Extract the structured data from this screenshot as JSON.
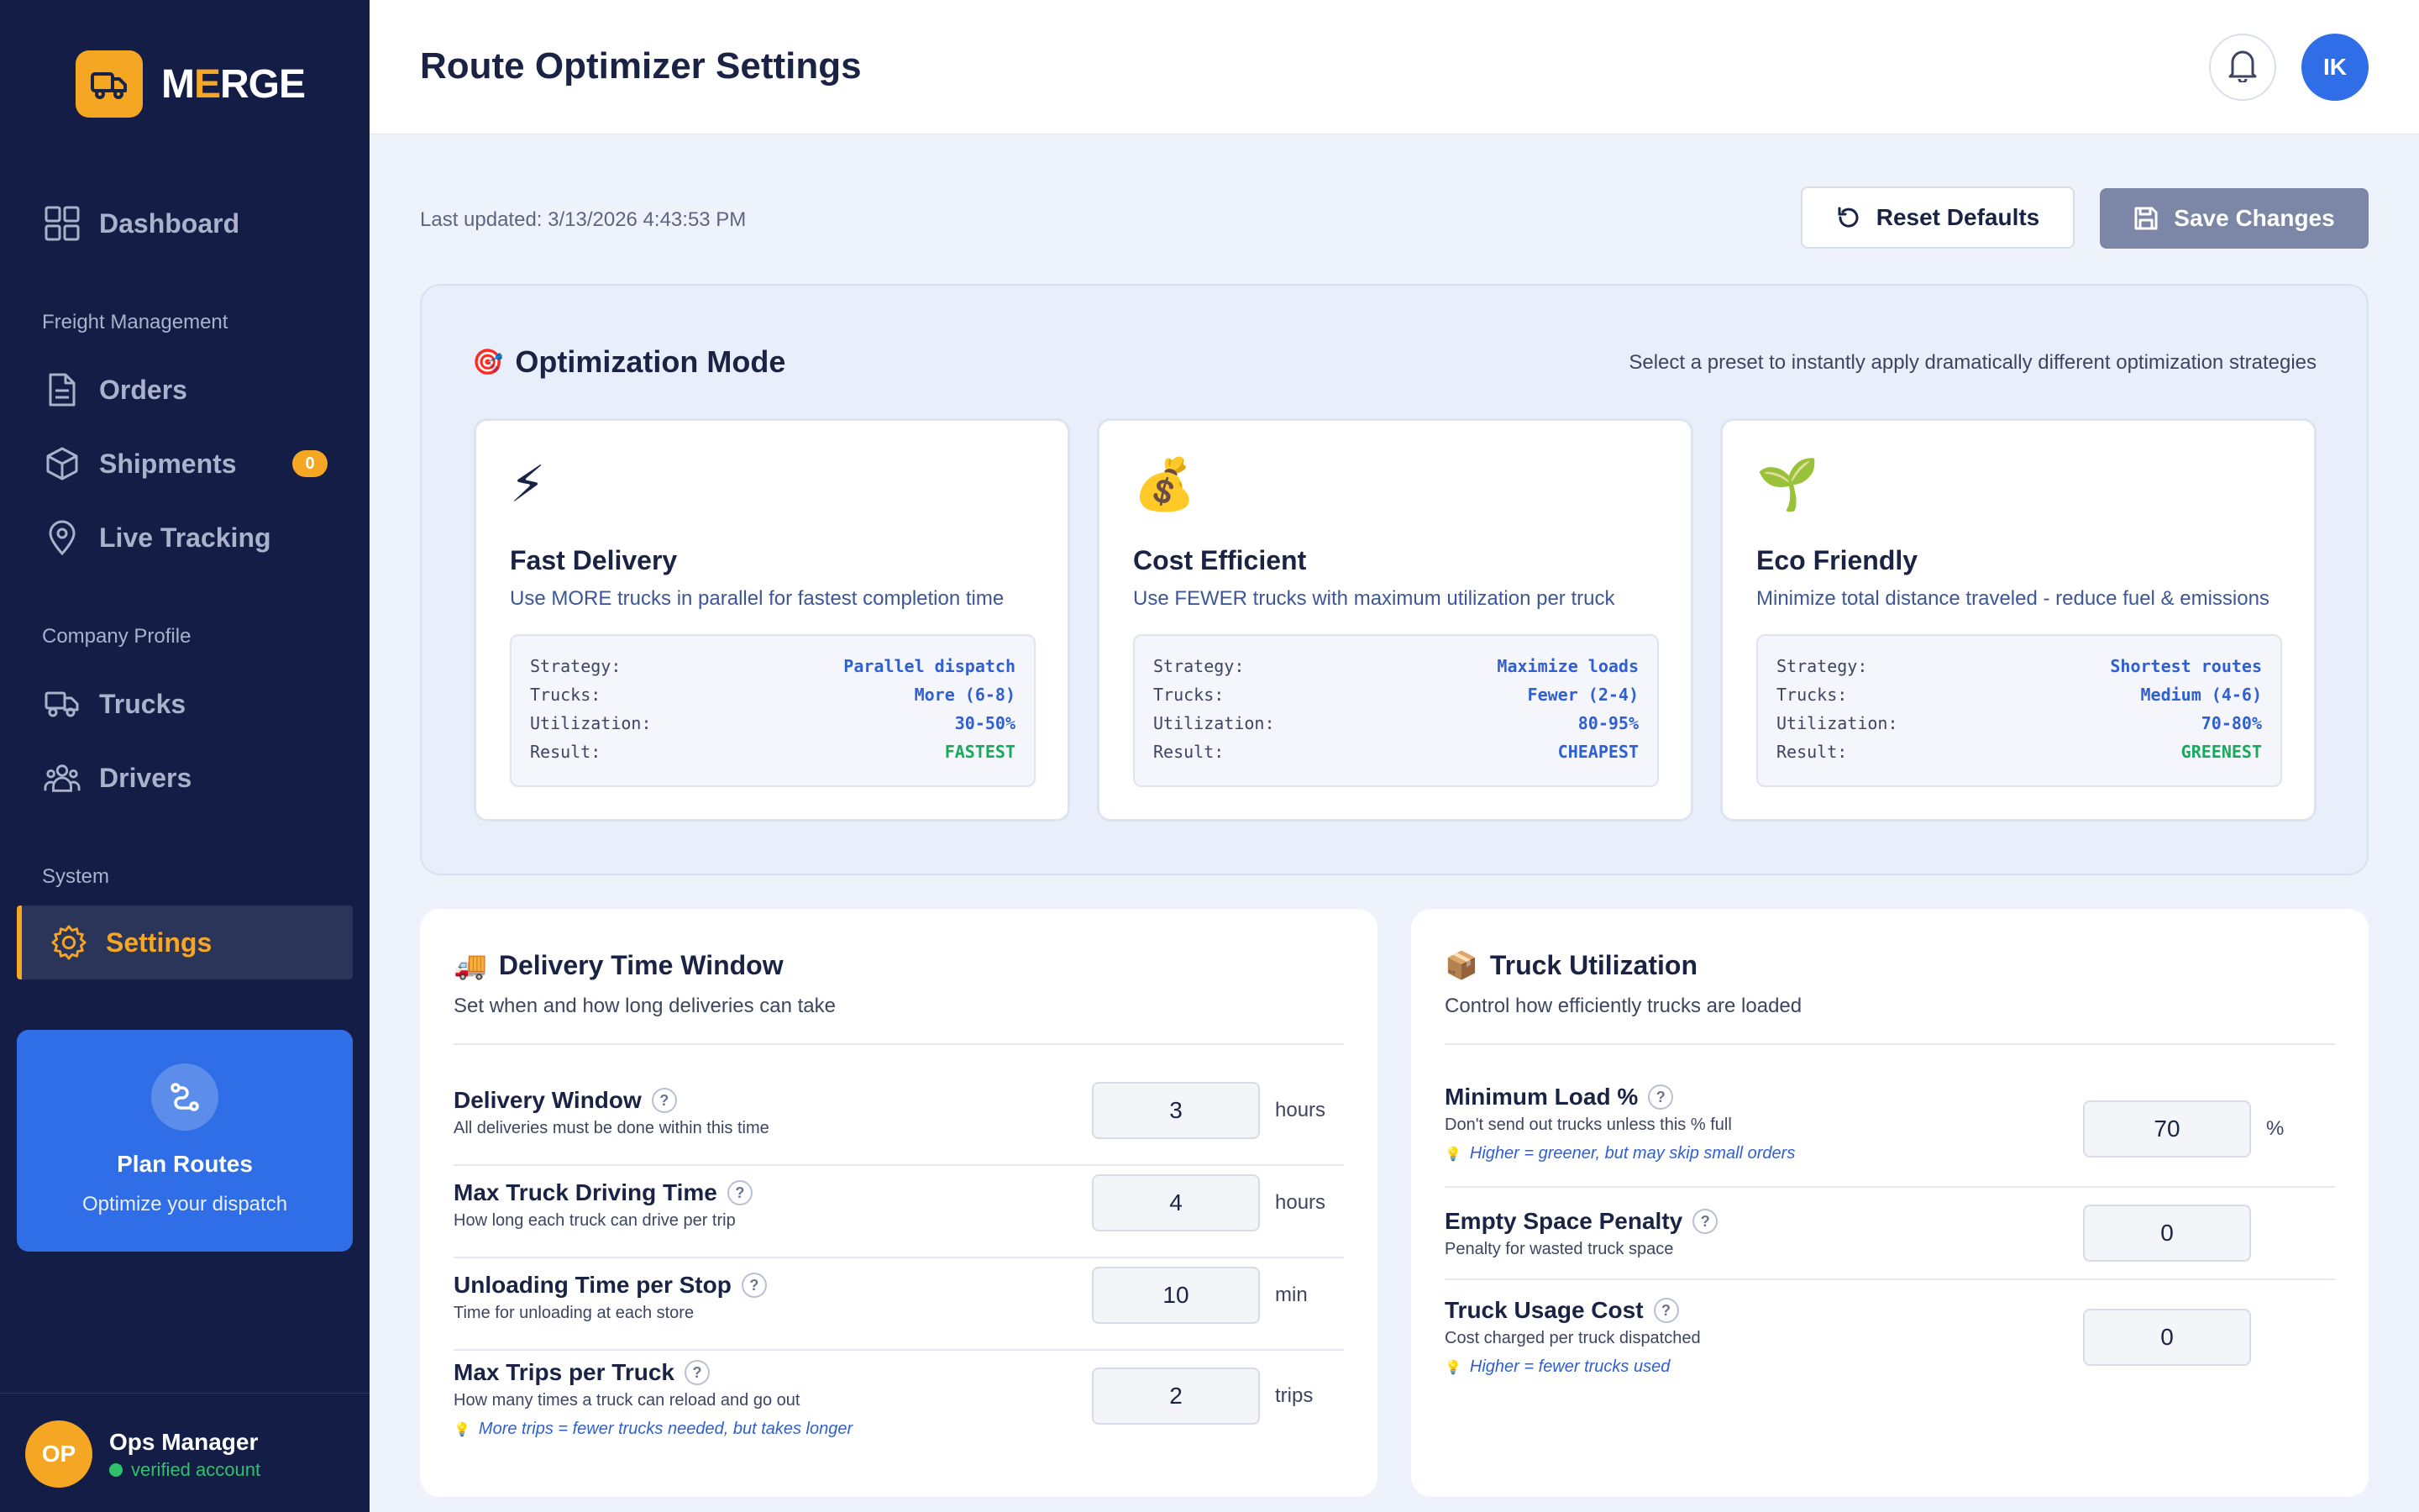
{
  "brand": {
    "name_pre": "M",
    "name_accent": "E",
    "name_post": "RGE"
  },
  "nav": {
    "dashboard": "Dashboard",
    "section_freight": "Freight Management",
    "orders": "Orders",
    "shipments": "Shipments",
    "shipments_badge": "0",
    "live_tracking": "Live Tracking",
    "section_company": "Company Profile",
    "trucks": "Trucks",
    "drivers": "Drivers",
    "section_system": "System",
    "settings": "Settings"
  },
  "plan_card": {
    "title": "Plan Routes",
    "subtitle": "Optimize your dispatch"
  },
  "user": {
    "initials": "OP",
    "name": "Ops Manager",
    "status": "verified account"
  },
  "header": {
    "title": "Route Optimizer Settings",
    "avatar_initials": "IK"
  },
  "toolbar": {
    "last_updated": "Last updated: 3/13/2026 4:43:53 PM",
    "reset_label": "Reset Defaults",
    "save_label": "Save Changes"
  },
  "optimization": {
    "title": "Optimization Mode",
    "hint": "Select a preset to instantly apply dramatically different optimization strategies",
    "modes": [
      {
        "icon": "⚡",
        "title": "Fast Delivery",
        "description": "Use MORE trucks in parallel for fastest completion time",
        "stats": [
          {
            "key": "Strategy:",
            "value": "Parallel dispatch"
          },
          {
            "key": "Trucks:",
            "value": "More (6-8)"
          },
          {
            "key": "Utilization:",
            "value": "30-50%"
          },
          {
            "key": "Result:",
            "value": "FASTEST"
          }
        ]
      },
      {
        "icon": "💰",
        "title": "Cost Efficient",
        "description": "Use FEWER trucks with maximum utilization per truck",
        "stats": [
          {
            "key": "Strategy:",
            "value": "Maximize loads"
          },
          {
            "key": "Trucks:",
            "value": "Fewer (2-4)"
          },
          {
            "key": "Utilization:",
            "value": "80-95%"
          },
          {
            "key": "Result:",
            "value": "CHEAPEST"
          }
        ]
      },
      {
        "icon": "🌱",
        "title": "Eco Friendly",
        "description": "Minimize total distance traveled - reduce fuel & emissions",
        "stats": [
          {
            "key": "Strategy:",
            "value": "Shortest routes"
          },
          {
            "key": "Trucks:",
            "value": "Medium (4-6)"
          },
          {
            "key": "Utilization:",
            "value": "70-80%"
          },
          {
            "key": "Result:",
            "value": "GREENEST"
          }
        ]
      }
    ]
  },
  "delivery_window": {
    "icon": "🚚",
    "title": "Delivery Time Window",
    "subtitle": "Set when and how long deliveries can take",
    "fields": [
      {
        "label": "Delivery Window",
        "description": "All deliveries must be done within this time",
        "value": "3",
        "unit": "hours"
      },
      {
        "label": "Max Truck Driving Time",
        "description": "How long each truck can drive per trip",
        "value": "4",
        "unit": "hours"
      },
      {
        "label": "Unloading Time per Stop",
        "description": "Time for unloading at each store",
        "value": "10",
        "unit": "min"
      },
      {
        "label": "Max Trips per Truck",
        "description": "How many times a truck can reload and go out",
        "value": "2",
        "unit": "trips",
        "tip": "More trips = fewer trucks needed, but takes longer"
      }
    ]
  },
  "truck_utilization": {
    "icon": "📦",
    "title": "Truck Utilization",
    "subtitle": "Control how efficiently trucks are loaded",
    "fields": [
      {
        "label": "Minimum Load %",
        "description": "Don't send out trucks unless this % full",
        "value": "70",
        "unit": "%",
        "tip": "Higher = greener, but may skip small orders"
      },
      {
        "label": "Empty Space Penalty",
        "description": "Penalty for wasted truck space",
        "value": "0"
      },
      {
        "label": "Truck Usage Cost",
        "description": "Cost charged per truck dispatched",
        "value": "0",
        "tip": "Higher = fewer trucks used"
      }
    ]
  },
  "help_glyph": "?",
  "tip_icon": "💡",
  "colors": {
    "sidebar_bg": "#131d46",
    "accent": "#f5a623",
    "primary": "#2f6ee6",
    "success": "#19a95a"
  }
}
